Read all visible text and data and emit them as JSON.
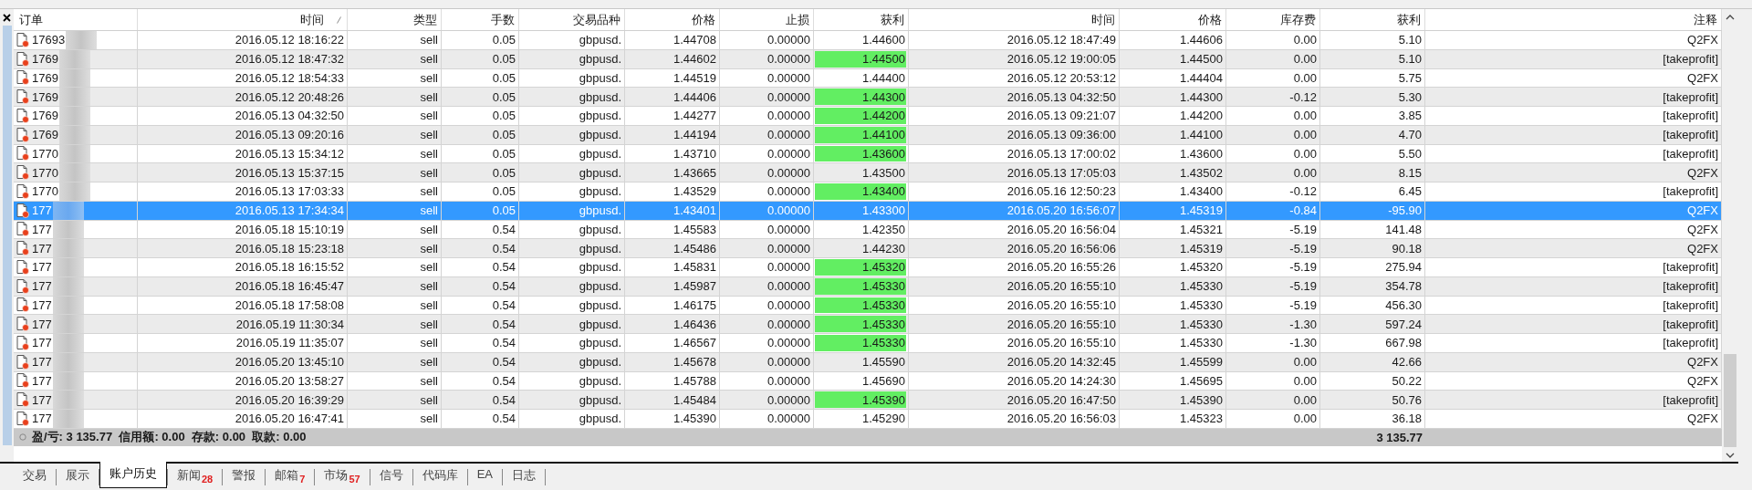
{
  "table": {
    "columns": [
      {
        "label": "订单",
        "sorted": false
      },
      {
        "label": "时间",
        "sorted": true
      },
      {
        "label": "类型",
        "sorted": false
      },
      {
        "label": "手数",
        "sorted": false
      },
      {
        "label": "交易品种",
        "sorted": false
      },
      {
        "label": "价格",
        "sorted": false
      },
      {
        "label": "止损",
        "sorted": false
      },
      {
        "label": "获利",
        "sorted": false
      },
      {
        "label": "时间",
        "sorted": false
      },
      {
        "label": "价格",
        "sorted": false
      },
      {
        "label": "库存费",
        "sorted": false
      },
      {
        "label": "获利",
        "sorted": false
      },
      {
        "label": "注释",
        "sorted": false
      }
    ],
    "rows": [
      {
        "order": "17693",
        "open_time": "2016.05.12 18:16:22",
        "type": "sell",
        "lots": "0.05",
        "symbol": "gbpusd.",
        "open_price": "1.44708",
        "sl": "0.00000",
        "tp": "1.44600",
        "tp_hit": false,
        "close_time": "2016.05.12 18:47:49",
        "close_price": "1.44606",
        "swap": "0.00",
        "profit": "5.10",
        "comment": "Q2FX",
        "selected": false
      },
      {
        "order": "1769",
        "open_time": "2016.05.12 18:47:32",
        "type": "sell",
        "lots": "0.05",
        "symbol": "gbpusd.",
        "open_price": "1.44602",
        "sl": "0.00000",
        "tp": "1.44500",
        "tp_hit": true,
        "close_time": "2016.05.12 19:00:05",
        "close_price": "1.44500",
        "swap": "0.00",
        "profit": "5.10",
        "comment": "[takeprofit]",
        "selected": false
      },
      {
        "order": "1769",
        "open_time": "2016.05.12 18:54:33",
        "type": "sell",
        "lots": "0.05",
        "symbol": "gbpusd.",
        "open_price": "1.44519",
        "sl": "0.00000",
        "tp": "1.44400",
        "tp_hit": false,
        "close_time": "2016.05.12 20:53:12",
        "close_price": "1.44404",
        "swap": "0.00",
        "profit": "5.75",
        "comment": "Q2FX",
        "selected": false
      },
      {
        "order": "1769",
        "open_time": "2016.05.12 20:48:26",
        "type": "sell",
        "lots": "0.05",
        "symbol": "gbpusd.",
        "open_price": "1.44406",
        "sl": "0.00000",
        "tp": "1.44300",
        "tp_hit": true,
        "close_time": "2016.05.13 04:32:50",
        "close_price": "1.44300",
        "swap": "-0.12",
        "profit": "5.30",
        "comment": "[takeprofit]",
        "selected": false
      },
      {
        "order": "1769",
        "open_time": "2016.05.13 04:32:50",
        "type": "sell",
        "lots": "0.05",
        "symbol": "gbpusd.",
        "open_price": "1.44277",
        "sl": "0.00000",
        "tp": "1.44200",
        "tp_hit": true,
        "close_time": "2016.05.13 09:21:07",
        "close_price": "1.44200",
        "swap": "0.00",
        "profit": "3.85",
        "comment": "[takeprofit]",
        "selected": false
      },
      {
        "order": "1769",
        "open_time": "2016.05.13 09:20:16",
        "type": "sell",
        "lots": "0.05",
        "symbol": "gbpusd.",
        "open_price": "1.44194",
        "sl": "0.00000",
        "tp": "1.44100",
        "tp_hit": true,
        "close_time": "2016.05.13 09:36:00",
        "close_price": "1.44100",
        "swap": "0.00",
        "profit": "4.70",
        "comment": "[takeprofit]",
        "selected": false
      },
      {
        "order": "1770",
        "open_time": "2016.05.13 15:34:12",
        "type": "sell",
        "lots": "0.05",
        "symbol": "gbpusd.",
        "open_price": "1.43710",
        "sl": "0.00000",
        "tp": "1.43600",
        "tp_hit": true,
        "close_time": "2016.05.13 17:00:02",
        "close_price": "1.43600",
        "swap": "0.00",
        "profit": "5.50",
        "comment": "[takeprofit]",
        "selected": false
      },
      {
        "order": "1770",
        "open_time": "2016.05.13 15:37:15",
        "type": "sell",
        "lots": "0.05",
        "symbol": "gbpusd.",
        "open_price": "1.43665",
        "sl": "0.00000",
        "tp": "1.43500",
        "tp_hit": false,
        "close_time": "2016.05.13 17:05:03",
        "close_price": "1.43502",
        "swap": "0.00",
        "profit": "8.15",
        "comment": "Q2FX",
        "selected": false
      },
      {
        "order": "1770",
        "open_time": "2016.05.13 17:03:33",
        "type": "sell",
        "lots": "0.05",
        "symbol": "gbpusd.",
        "open_price": "1.43529",
        "sl": "0.00000",
        "tp": "1.43400",
        "tp_hit": true,
        "close_time": "2016.05.16 12:50:23",
        "close_price": "1.43400",
        "swap": "-0.12",
        "profit": "6.45",
        "comment": "[takeprofit]",
        "selected": false
      },
      {
        "order": "177",
        "open_time": "2016.05.13 17:34:34",
        "type": "sell",
        "lots": "0.05",
        "symbol": "gbpusd.",
        "open_price": "1.43401",
        "sl": "0.00000",
        "tp": "1.43300",
        "tp_hit": false,
        "close_time": "2016.05.20 16:56:07",
        "close_price": "1.45319",
        "swap": "-0.84",
        "profit": "-95.90",
        "comment": "Q2FX",
        "selected": true
      },
      {
        "order": "177",
        "open_time": "2016.05.18 15:10:19",
        "type": "sell",
        "lots": "0.54",
        "symbol": "gbpusd.",
        "open_price": "1.45583",
        "sl": "0.00000",
        "tp": "1.42350",
        "tp_hit": false,
        "close_time": "2016.05.20 16:56:04",
        "close_price": "1.45321",
        "swap": "-5.19",
        "profit": "141.48",
        "comment": "Q2FX",
        "selected": false
      },
      {
        "order": "177",
        "open_time": "2016.05.18 15:23:18",
        "type": "sell",
        "lots": "0.54",
        "symbol": "gbpusd.",
        "open_price": "1.45486",
        "sl": "0.00000",
        "tp": "1.44230",
        "tp_hit": false,
        "close_time": "2016.05.20 16:56:06",
        "close_price": "1.45319",
        "swap": "-5.19",
        "profit": "90.18",
        "comment": "Q2FX",
        "selected": false
      },
      {
        "order": "177",
        "open_time": "2016.05.18 16:15:52",
        "type": "sell",
        "lots": "0.54",
        "symbol": "gbpusd.",
        "open_price": "1.45831",
        "sl": "0.00000",
        "tp": "1.45320",
        "tp_hit": true,
        "close_time": "2016.05.20 16:55:26",
        "close_price": "1.45320",
        "swap": "-5.19",
        "profit": "275.94",
        "comment": "[takeprofit]",
        "selected": false
      },
      {
        "order": "177",
        "open_time": "2016.05.18 16:45:47",
        "type": "sell",
        "lots": "0.54",
        "symbol": "gbpusd.",
        "open_price": "1.45987",
        "sl": "0.00000",
        "tp": "1.45330",
        "tp_hit": true,
        "close_time": "2016.05.20 16:55:10",
        "close_price": "1.45330",
        "swap": "-5.19",
        "profit": "354.78",
        "comment": "[takeprofit]",
        "selected": false
      },
      {
        "order": "177",
        "open_time": "2016.05.18 17:58:08",
        "type": "sell",
        "lots": "0.54",
        "symbol": "gbpusd.",
        "open_price": "1.46175",
        "sl": "0.00000",
        "tp": "1.45330",
        "tp_hit": true,
        "close_time": "2016.05.20 16:55:10",
        "close_price": "1.45330",
        "swap": "-5.19",
        "profit": "456.30",
        "comment": "[takeprofit]",
        "selected": false
      },
      {
        "order": "177",
        "open_time": "2016.05.19 11:30:34",
        "type": "sell",
        "lots": "0.54",
        "symbol": "gbpusd.",
        "open_price": "1.46436",
        "sl": "0.00000",
        "tp": "1.45330",
        "tp_hit": true,
        "close_time": "2016.05.20 16:55:10",
        "close_price": "1.45330",
        "swap": "-1.30",
        "profit": "597.24",
        "comment": "[takeprofit]",
        "selected": false
      },
      {
        "order": "177",
        "open_time": "2016.05.19 11:35:07",
        "type": "sell",
        "lots": "0.54",
        "symbol": "gbpusd.",
        "open_price": "1.46567",
        "sl": "0.00000",
        "tp": "1.45330",
        "tp_hit": true,
        "close_time": "2016.05.20 16:55:10",
        "close_price": "1.45330",
        "swap": "-1.30",
        "profit": "667.98",
        "comment": "[takeprofit]",
        "selected": false
      },
      {
        "order": "177",
        "open_time": "2016.05.20 13:45:10",
        "type": "sell",
        "lots": "0.54",
        "symbol": "gbpusd.",
        "open_price": "1.45678",
        "sl": "0.00000",
        "tp": "1.45590",
        "tp_hit": false,
        "close_time": "2016.05.20 14:32:45",
        "close_price": "1.45599",
        "swap": "0.00",
        "profit": "42.66",
        "comment": "Q2FX",
        "selected": false
      },
      {
        "order": "177",
        "open_time": "2016.05.20 13:58:27",
        "type": "sell",
        "lots": "0.54",
        "symbol": "gbpusd.",
        "open_price": "1.45788",
        "sl": "0.00000",
        "tp": "1.45690",
        "tp_hit": false,
        "close_time": "2016.05.20 14:24:30",
        "close_price": "1.45695",
        "swap": "0.00",
        "profit": "50.22",
        "comment": "Q2FX",
        "selected": false
      },
      {
        "order": "177",
        "open_time": "2016.05.20 16:39:29",
        "type": "sell",
        "lots": "0.54",
        "symbol": "gbpusd.",
        "open_price": "1.45484",
        "sl": "0.00000",
        "tp": "1.45390",
        "tp_hit": true,
        "close_time": "2016.05.20 16:47:50",
        "close_price": "1.45390",
        "swap": "0.00",
        "profit": "50.76",
        "comment": "[takeprofit]",
        "selected": false
      },
      {
        "order": "177",
        "open_time": "2016.05.20 16:47:41",
        "type": "sell",
        "lots": "0.54",
        "symbol": "gbpusd.",
        "open_price": "1.45390",
        "sl": "0.00000",
        "tp": "1.45290",
        "tp_hit": false,
        "close_time": "2016.05.20 16:56:03",
        "close_price": "1.45323",
        "swap": "0.00",
        "profit": "36.18",
        "comment": "Q2FX",
        "selected": false
      }
    ],
    "summary": {
      "text": "盈/亏: 3 135.77  信用额: 0.00  存款: 0.00  取款: 0.00",
      "total": "3 135.77"
    }
  },
  "tabs": [
    {
      "label": "交易",
      "selected": false
    },
    {
      "label": "展示",
      "selected": false
    },
    {
      "label": "账户历史",
      "selected": true
    },
    {
      "label": "新闻",
      "count": "28",
      "selected": false
    },
    {
      "label": "警报",
      "selected": false
    },
    {
      "label": "邮箱",
      "count": "7",
      "selected": false
    },
    {
      "label": "市场",
      "count": "57",
      "selected": false
    },
    {
      "label": "信号",
      "selected": false
    },
    {
      "label": "代码库",
      "selected": false
    },
    {
      "label": "EA",
      "selected": false
    },
    {
      "label": "日志",
      "selected": false
    }
  ]
}
